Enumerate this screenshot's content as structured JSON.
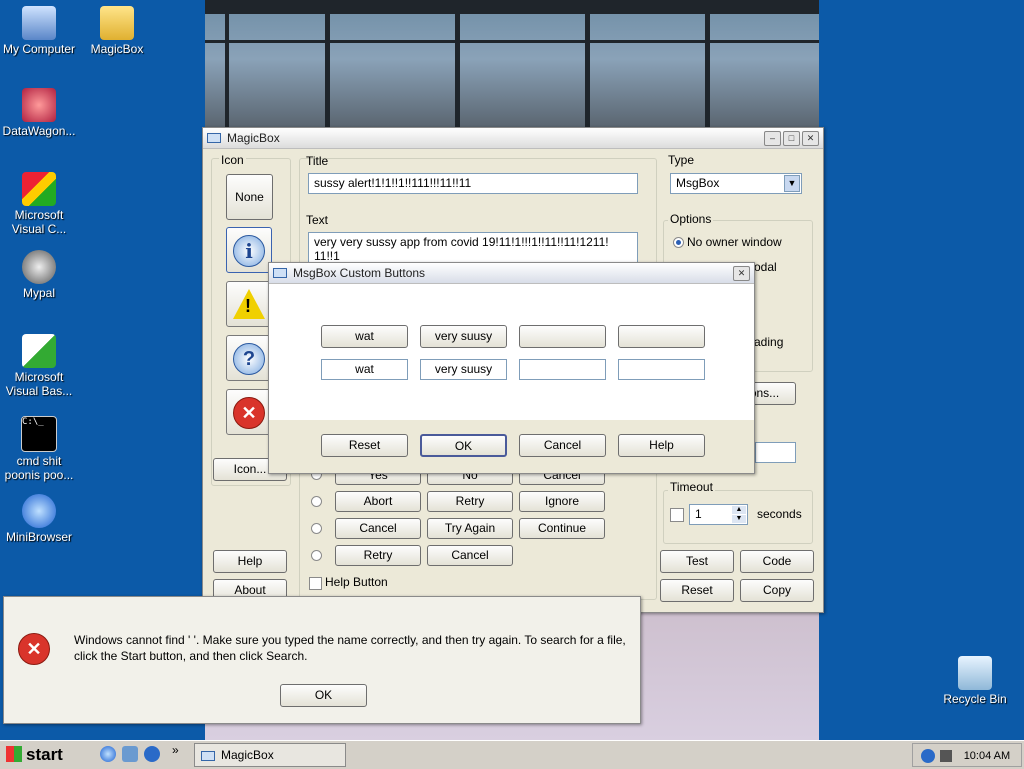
{
  "desktop": {
    "icons": [
      {
        "label": "My Computer",
        "icon": "computer-icon"
      },
      {
        "label": "MagicBox",
        "icon": "folder-icon"
      },
      {
        "label": "DataWagon...",
        "icon": "shortcut-icon"
      },
      {
        "label": "Microsoft Visual C...",
        "icon": "visual-c-icon"
      },
      {
        "label": "Mypal",
        "icon": "raccoon-icon"
      },
      {
        "label": "Microsoft Visual Bas...",
        "icon": "visual-basic-icon"
      },
      {
        "label": "cmd shit poonis poo...",
        "icon": "cmd-icon"
      },
      {
        "label": "MiniBrowser",
        "icon": "browser-icon"
      },
      {
        "label": "Recycle Bin",
        "icon": "recycle-bin-icon"
      }
    ]
  },
  "magicbox": {
    "title": "MagicBox",
    "icon_group_label": "Icon",
    "icon_none": "None",
    "icon_button": "Icon...",
    "help": "Help",
    "about": "About",
    "title_label": "Title",
    "title_value": "sussy alert!1!1!!1!!111!!!11!!11",
    "text_label": "Text",
    "text_value": "very very sussy app from covid 19!11!1!!!1!!11!!11!1211! 11!!1",
    "type_label": "Type",
    "type_value": "MsgBox",
    "options_label": "Options",
    "option_no_owner": "No owner window",
    "option_modal_partial": "odal",
    "option_loading_partial": "ading",
    "custom_buttons_partial": "ons...",
    "button_rows": [
      [
        "Yes",
        "No",
        "Cancel"
      ],
      [
        "Abort",
        "Retry",
        "Ignore"
      ],
      [
        "Cancel",
        "Try Again",
        "Continue"
      ],
      [
        "Retry",
        "Cancel"
      ]
    ],
    "help_button_label": "Help Button",
    "timeout_label": "Timeout",
    "timeout_value": "1",
    "timeout_unit": "seconds",
    "test": "Test",
    "code": "Code",
    "reset": "Reset",
    "copy": "Copy"
  },
  "custom_dialog": {
    "title": "MsgBox Custom Buttons",
    "preview_buttons": [
      "wat",
      "very suusy",
      "",
      ""
    ],
    "inputs": [
      "wat",
      "very suusy",
      "",
      ""
    ],
    "reset": "Reset",
    "ok": "OK",
    "cancel": "Cancel",
    "help": "Help"
  },
  "error_dialog": {
    "message_line1": "Windows cannot find '   '. Make sure you typed the name correctly, and then try again. To search for a file,",
    "message_line2": "click the Start button, and then click Search.",
    "ok": "OK"
  },
  "taskbar": {
    "start": "start",
    "task": "MagicBox",
    "clock": "10:04 AM"
  },
  "colors": {
    "desktop": "#0c5aa8",
    "taskbar": "#d4d0c8",
    "error": "#d9342b"
  }
}
